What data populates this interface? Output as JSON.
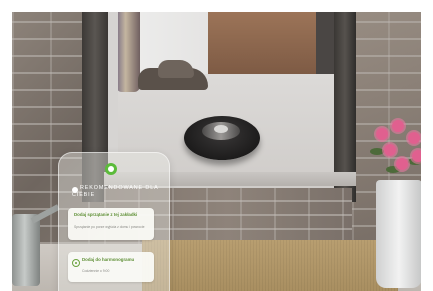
{
  "app": {
    "recommendation_title_line1": "REKOMENDOWANE DLA",
    "recommendation_title_line2": "CIEBIE",
    "accent_color": "#5bbb3a"
  },
  "cards": [
    {
      "title": "Dodaj sprzątanie z tej zakładki",
      "subtitle": "Sprzątanie po porze wyjścia z domu i powrocie",
      "icon": "none"
    },
    {
      "title": "Dodaj do harmonogramu",
      "subtitle": "Codziennie o 9:00",
      "icon": "target-icon"
    }
  ],
  "icons": {
    "logo": "roomba-leaf-icon",
    "recommendation": "dot-icon"
  }
}
